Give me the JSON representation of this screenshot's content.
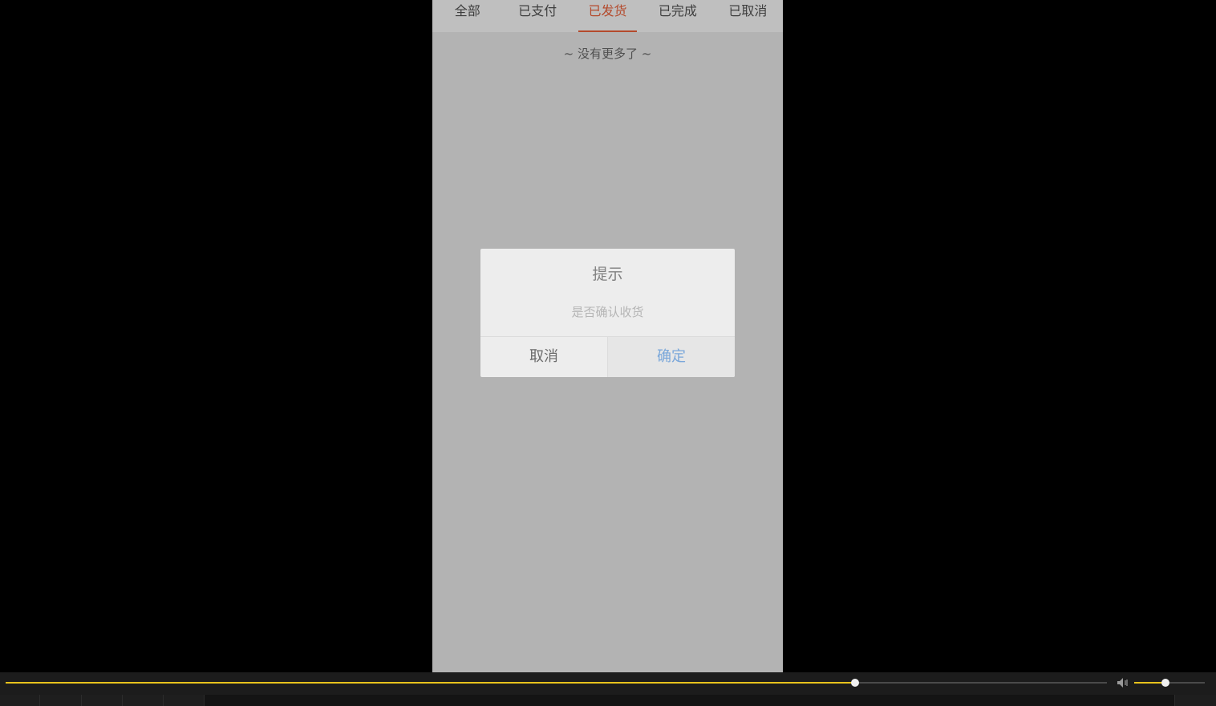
{
  "tabs": [
    {
      "label": "全部",
      "active": false
    },
    {
      "label": "已支付",
      "active": false
    },
    {
      "label": "已发货",
      "active": true
    },
    {
      "label": "已完成",
      "active": false
    },
    {
      "label": "已取消",
      "active": false
    }
  ],
  "list": {
    "no_more_text": "~ 没有更多了 ~"
  },
  "dialog": {
    "title": "提示",
    "message": "是否确认收货",
    "cancel_label": "取消",
    "confirm_label": "确定"
  },
  "player": {
    "progress_fraction": 0.771,
    "volume_fraction": 0.44,
    "volume_icon": "speaker-icon"
  },
  "colors": {
    "accent": "#b44a2c",
    "progress": "#e7c21c",
    "confirm_text": "#7aa7da"
  }
}
